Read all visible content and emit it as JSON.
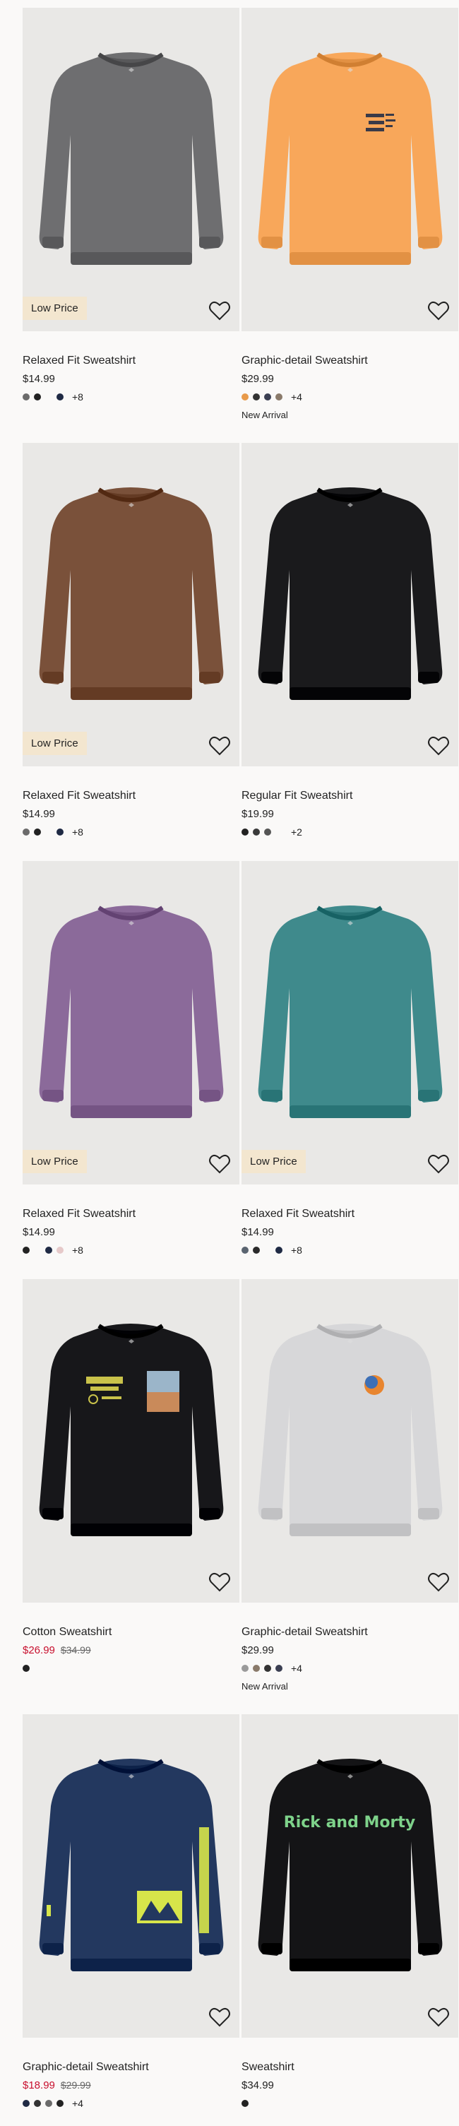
{
  "products": [
    {
      "title": "Relaxed Fit Sweatshirt",
      "price": "$14.99",
      "badge": "Low Price",
      "swatches": [
        "#6b6b6b",
        "#222222",
        "",
        "#1f2a44"
      ],
      "more": "+8",
      "tag": "",
      "color": "#6e6e70",
      "print": "none"
    },
    {
      "title": "Graphic-detail Sweatshirt",
      "price": "$29.99",
      "badge": "",
      "swatches": [
        "#e89a4a",
        "#333333",
        "#3b3f52",
        "#8a7a6a"
      ],
      "more": "+4",
      "tag": "New Arrival",
      "color": "#f8a75a",
      "print": "chest-right"
    },
    {
      "title": "Relaxed Fit Sweatshirt",
      "price": "$14.99",
      "badge": "Low Price",
      "swatches": [
        "#6b6b6b",
        "#222222",
        "",
        "#1f2a44"
      ],
      "more": "+8",
      "tag": "",
      "color": "#7a513a",
      "print": "none"
    },
    {
      "title": "Regular Fit Sweatshirt",
      "price": "$19.99",
      "badge": "",
      "swatches": [
        "#222222",
        "#3a3a3a",
        "#555555",
        ""
      ],
      "more": "+2",
      "tag": "",
      "color": "#1a1a1c",
      "print": "none"
    },
    {
      "title": "Relaxed Fit Sweatshirt",
      "price": "$14.99",
      "badge": "Low Price",
      "swatches": [
        "#222222",
        "",
        "#1f2a44",
        "#e6c9c9"
      ],
      "more": "+8",
      "tag": "",
      "color": "#8b6a9a",
      "print": "none"
    },
    {
      "title": "Relaxed Fit Sweatshirt",
      "price": "$14.99",
      "badge": "Low Price",
      "swatches": [
        "#5a6470",
        "#2a2a2a",
        "",
        "#1f2a44"
      ],
      "more": "+8",
      "tag": "",
      "color": "#3f8a8c",
      "print": "none"
    },
    {
      "title": "Cotton Sweatshirt",
      "price": "",
      "sale_price": "$26.99",
      "orig_price": "$34.99",
      "badge": "",
      "swatches": [
        "#222222"
      ],
      "more": "",
      "tag": "",
      "color": "#17171a",
      "print": "graphic"
    },
    {
      "title": "Graphic-detail Sweatshirt",
      "price": "$29.99",
      "badge": "",
      "swatches": [
        "#9a9a9a",
        "#8a7a6a",
        "#333333",
        "#3b3f52"
      ],
      "more": "+4",
      "tag": "New Arrival",
      "color": "#d7d7d9",
      "print": "ball"
    },
    {
      "title": "Graphic-detail Sweatshirt",
      "price": "",
      "sale_price": "$18.99",
      "orig_price": "$29.99",
      "badge": "",
      "swatches": [
        "#1f2a44",
        "#333333",
        "#6b6b6b",
        "#222222"
      ],
      "more": "+4",
      "tag": "",
      "color": "#23385f",
      "print": "sleeve"
    },
    {
      "title": "Sweatshirt",
      "price": "$34.99",
      "badge": "",
      "swatches": [
        "#222222"
      ],
      "more": "",
      "tag": "",
      "color": "#141416",
      "print": "logo"
    }
  ]
}
